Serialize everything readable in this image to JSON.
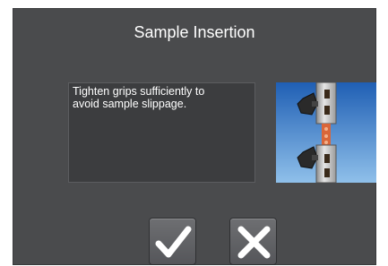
{
  "dialog": {
    "title": "Sample Insertion",
    "message": "Tighten grips sufficiently to\navoid sample slippage.",
    "illustration_icon": "grips-with-sample-icon",
    "confirm_icon": "checkmark-icon",
    "cancel_icon": "close-icon"
  },
  "colors": {
    "background": "#4a4b4d",
    "message_box": "#3c3d3f",
    "illustration_sky": "#2f6fc0",
    "icon_white": "#ffffff"
  }
}
